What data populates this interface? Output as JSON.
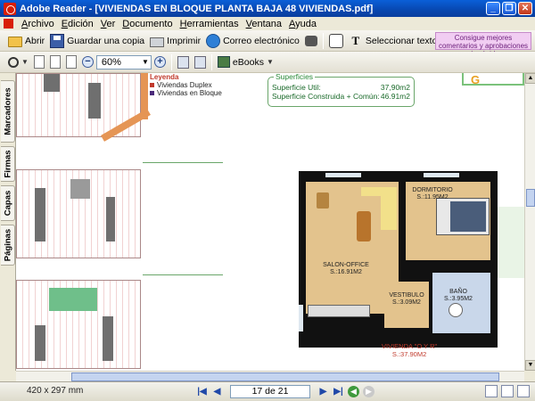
{
  "window": {
    "app_name": "Adobe Reader",
    "title": "Adobe Reader - [VIVIENDAS EN BLOQUE PLANTA BAJA 48 VIVIENDAS.pdf]",
    "buttons": {
      "minimize": "_",
      "maximize": "❐",
      "close": "✕"
    }
  },
  "menu": [
    "Archivo",
    "Edición",
    "Ver",
    "Documento",
    "Herramientas",
    "Ventana",
    "Ayuda"
  ],
  "toolbar1": {
    "open": "Abrir",
    "save_copy": "Guardar una copia",
    "print": "Imprimir",
    "email": "Correo electrónico",
    "select_text": "Seleccionar texto",
    "promo": "Consigue mejores comentarios y aprobaciones más rápidas"
  },
  "toolbar2": {
    "zoom_value": "60%",
    "zoom_out": "−",
    "zoom_in": "+",
    "ebooks": "eBooks"
  },
  "nav_tabs": [
    "Marcadores",
    "Firmas",
    "Capas",
    "Páginas"
  ],
  "document": {
    "legend_title": "Leyenda",
    "legend_items": [
      {
        "label": "Viviendas Duplex",
        "color": "#c0392b"
      },
      {
        "label": "Viviendas en Bloque",
        "color": "#4a2a7a"
      }
    ],
    "surfaces_title": "Superficies",
    "surfaces": [
      {
        "label": "Superficie Util:",
        "value": "37,90m2"
      },
      {
        "label": "Superficie Construida + Común:",
        "value": "46.91m2"
      }
    ],
    "rooms": [
      {
        "name": "DORMITORIO",
        "area": "S.:11.95M2"
      },
      {
        "name": "SALON-OFFICE",
        "area": "S.:16.91M2"
      },
      {
        "name": "VESTIBULO",
        "area": "S.:3.09M2"
      },
      {
        "name": "BAÑO",
        "area": "S.:3.95M2"
      }
    ],
    "unit_name": "VIVIENDA \"O Y R\"",
    "unit_area": "S.:37.90M2"
  },
  "status": {
    "page_size": "420 x 297 mm",
    "page_indicator": "17 de 21"
  },
  "colors": {
    "titlebar": "#0847b0",
    "accent_red": "#d81e05",
    "surface_green": "#1a6a2a"
  }
}
